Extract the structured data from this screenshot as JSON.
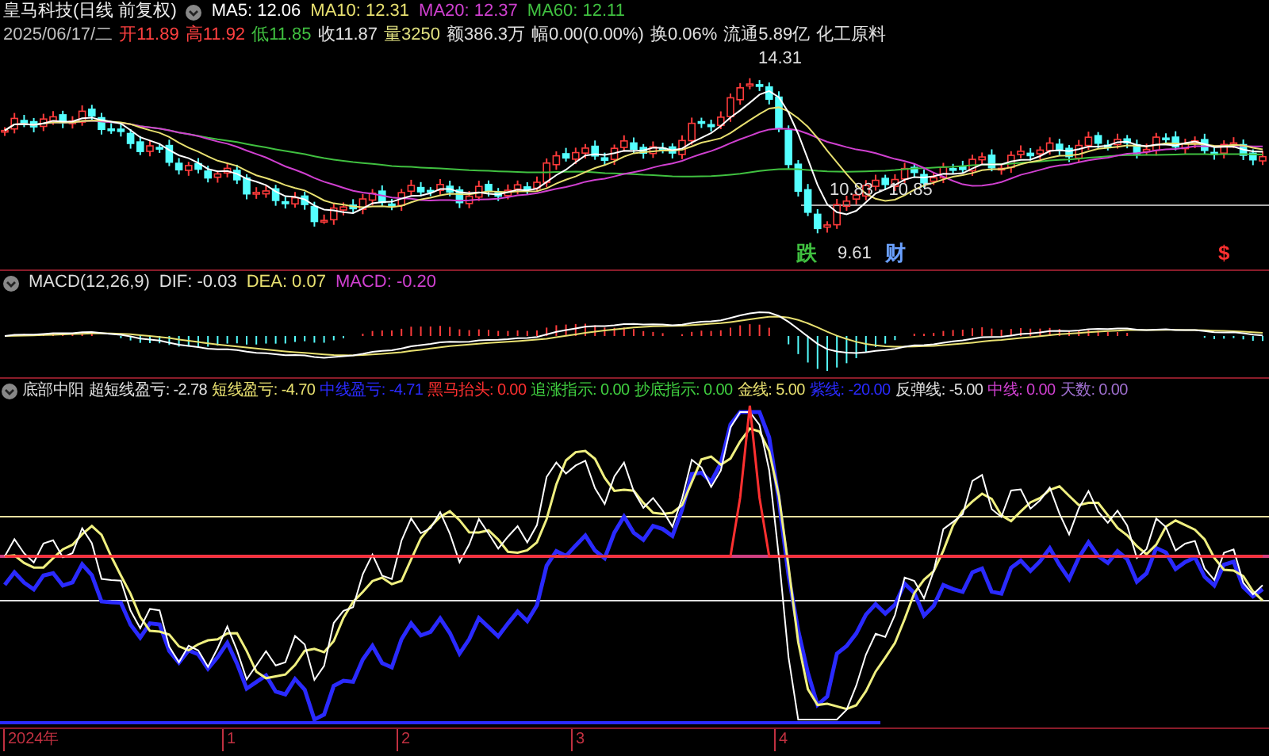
{
  "title": "皇马科技(日线 前复权)",
  "ma_legend": [
    {
      "text": "MA5: 12.06",
      "color": "#ffffff"
    },
    {
      "text": "MA10: 12.31",
      "color": "#e8e070"
    },
    {
      "text": "MA20: 12.37",
      "color": "#d040d0"
    },
    {
      "text": "MA60: 12.11",
      "color": "#40c040"
    }
  ],
  "quote": [
    {
      "text": "2025/06/17/二",
      "color": "#c0c0c0"
    },
    {
      "text": "开11.89",
      "color": "#ff4040"
    },
    {
      "text": "高11.92",
      "color": "#ff4040"
    },
    {
      "text": "低11.85",
      "color": "#40c040"
    },
    {
      "text": "收11.87",
      "color": "#e0e0e0"
    },
    {
      "text": "量3250",
      "color": "#e0e080"
    },
    {
      "text": "额386.3万",
      "color": "#e0e0e0"
    },
    {
      "text": "幅0.00(0.00%)",
      "color": "#e0e0e0"
    },
    {
      "text": "换0.06%",
      "color": "#e0e0e0"
    },
    {
      "text": "流通5.89亿",
      "color": "#e0e0e0"
    },
    {
      "text": "化工原料",
      "color": "#e0e0e0"
    }
  ],
  "price_chart": {
    "annotations": [
      "14.31",
      "10.83 - 10.85",
      "9.61"
    ],
    "markers": [
      {
        "text": "跌",
        "color": "#40c040"
      },
      {
        "text": "财",
        "color": "#6aa0ff"
      },
      {
        "text": "$",
        "color": "#ff3030"
      }
    ]
  },
  "macd": {
    "name": "MACD(12,26,9)",
    "legend": [
      {
        "text": "DIF: -0.03",
        "color": "#e0e0e0"
      },
      {
        "text": "DEA: 0.07",
        "color": "#e8e070"
      },
      {
        "text": "MACD: -0.20",
        "color": "#d040d0"
      }
    ]
  },
  "indicator": {
    "name": "底部中阳",
    "legend": [
      {
        "text": "超短线盈亏: -2.78",
        "color": "#e0e0e0"
      },
      {
        "text": "短线盈亏: -4.70",
        "color": "#e8e070"
      },
      {
        "text": "中线盈亏: -4.71",
        "color": "#2a2aff"
      },
      {
        "text": "黑马抬头: 0.00",
        "color": "#ff3030"
      },
      {
        "text": "追涨指示: 0.00",
        "color": "#40d040"
      },
      {
        "text": "抄底指示: 0.00",
        "color": "#40d040"
      },
      {
        "text": "金线: 5.00",
        "color": "#e8e070"
      },
      {
        "text": "紫线: -20.00",
        "color": "#2a2aff"
      },
      {
        "text": "反弹线: -5.00",
        "color": "#e0e0e0"
      },
      {
        "text": "中线: 0.00",
        "color": "#d040d0"
      },
      {
        "text": "天数: 0.00",
        "color": "#a070d0"
      }
    ]
  },
  "time_axis": [
    "2024年",
    "1",
    "2",
    "3",
    "4"
  ]
}
